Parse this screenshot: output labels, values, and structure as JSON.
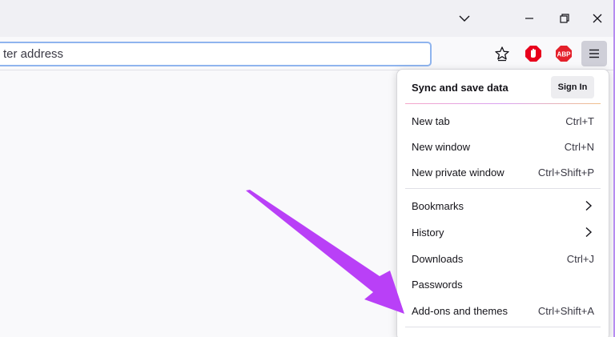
{
  "window": {
    "controls": {
      "tabs_dropdown_icon": "chevron-down-icon",
      "minimize_icon": "minimize-icon",
      "restore_icon": "restore-icon",
      "close_icon": "close-icon"
    }
  },
  "toolbar": {
    "urlbar_placeholder": "ter address",
    "icons": [
      "bookmark-star-icon",
      "ublock-origin-icon",
      "adblock-plus-icon",
      "hamburger-menu-icon"
    ],
    "abp_text": "ABP"
  },
  "menu": {
    "header": {
      "title": "Sync and save data",
      "signin_label": "Sign In"
    },
    "items": [
      {
        "label": "New tab",
        "shortcut": "Ctrl+T"
      },
      {
        "label": "New window",
        "shortcut": "Ctrl+N"
      },
      {
        "label": "New private window",
        "shortcut": "Ctrl+Shift+P"
      },
      {
        "label": "Bookmarks",
        "submenu": true
      },
      {
        "label": "History",
        "submenu": true
      },
      {
        "label": "Downloads",
        "shortcut": "Ctrl+J"
      },
      {
        "label": "Passwords"
      },
      {
        "label": "Add-ons and themes",
        "shortcut": "Ctrl+Shift+A"
      }
    ]
  },
  "annotation": {
    "arrow_color": "#b940f7"
  },
  "colors": {
    "accent": "#b940f7",
    "focus_border": "#8fb4ee",
    "ublock_red": "#e8001c",
    "abp_red": "#e4212b"
  }
}
